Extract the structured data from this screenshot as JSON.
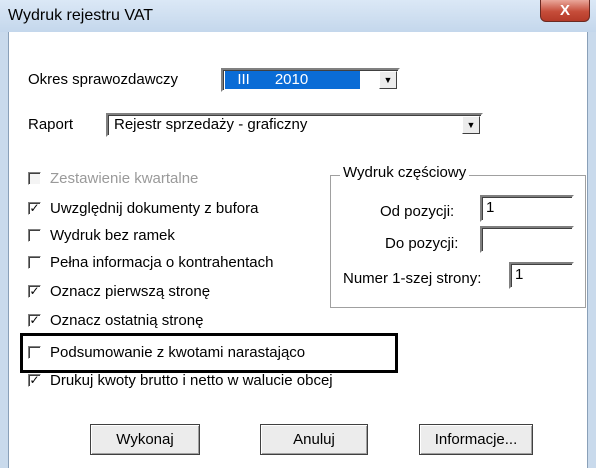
{
  "window": {
    "title": "Wydruk rejestru VAT",
    "close_glyph": "X"
  },
  "period": {
    "label": "Okres sprawozdawczy",
    "value": "  III      2010"
  },
  "report": {
    "label": "Raport",
    "value": "Rejestr sprzedaży - graficzny"
  },
  "options": [
    {
      "label": "Zestawienie kwartalne",
      "checked": false,
      "disabled": true
    },
    {
      "label": "Uwzględnij dokumenty z bufora",
      "checked": true,
      "disabled": false
    },
    {
      "label": "Wydruk bez ramek",
      "checked": false,
      "disabled": false
    },
    {
      "label": "Pełna informacja o kontrahentach",
      "checked": false,
      "disabled": false
    },
    {
      "label": "Oznacz pierwszą stronę",
      "checked": true,
      "disabled": false
    },
    {
      "label": "Oznacz ostatnią stronę",
      "checked": true,
      "disabled": false
    },
    {
      "label": "Podsumowanie z kwotami narastająco",
      "checked": false,
      "disabled": false
    },
    {
      "label": "Drukuj kwoty brutto i netto w walucie obcej",
      "checked": true,
      "disabled": false
    }
  ],
  "partial": {
    "title": "Wydruk częściowy",
    "from_label": "Od pozycji:",
    "from_value": "1",
    "to_label": "Do pozycji:",
    "to_value": "",
    "first_page_label": "Numer 1-szej strony:",
    "first_page_value": "1"
  },
  "buttons": {
    "execute": "Wykonaj",
    "cancel": "Anuluj",
    "info": "Informacje..."
  },
  "icons": {
    "combo_arrow": "dropdown-arrow-icon",
    "checkmark": "checkmark-icon"
  }
}
